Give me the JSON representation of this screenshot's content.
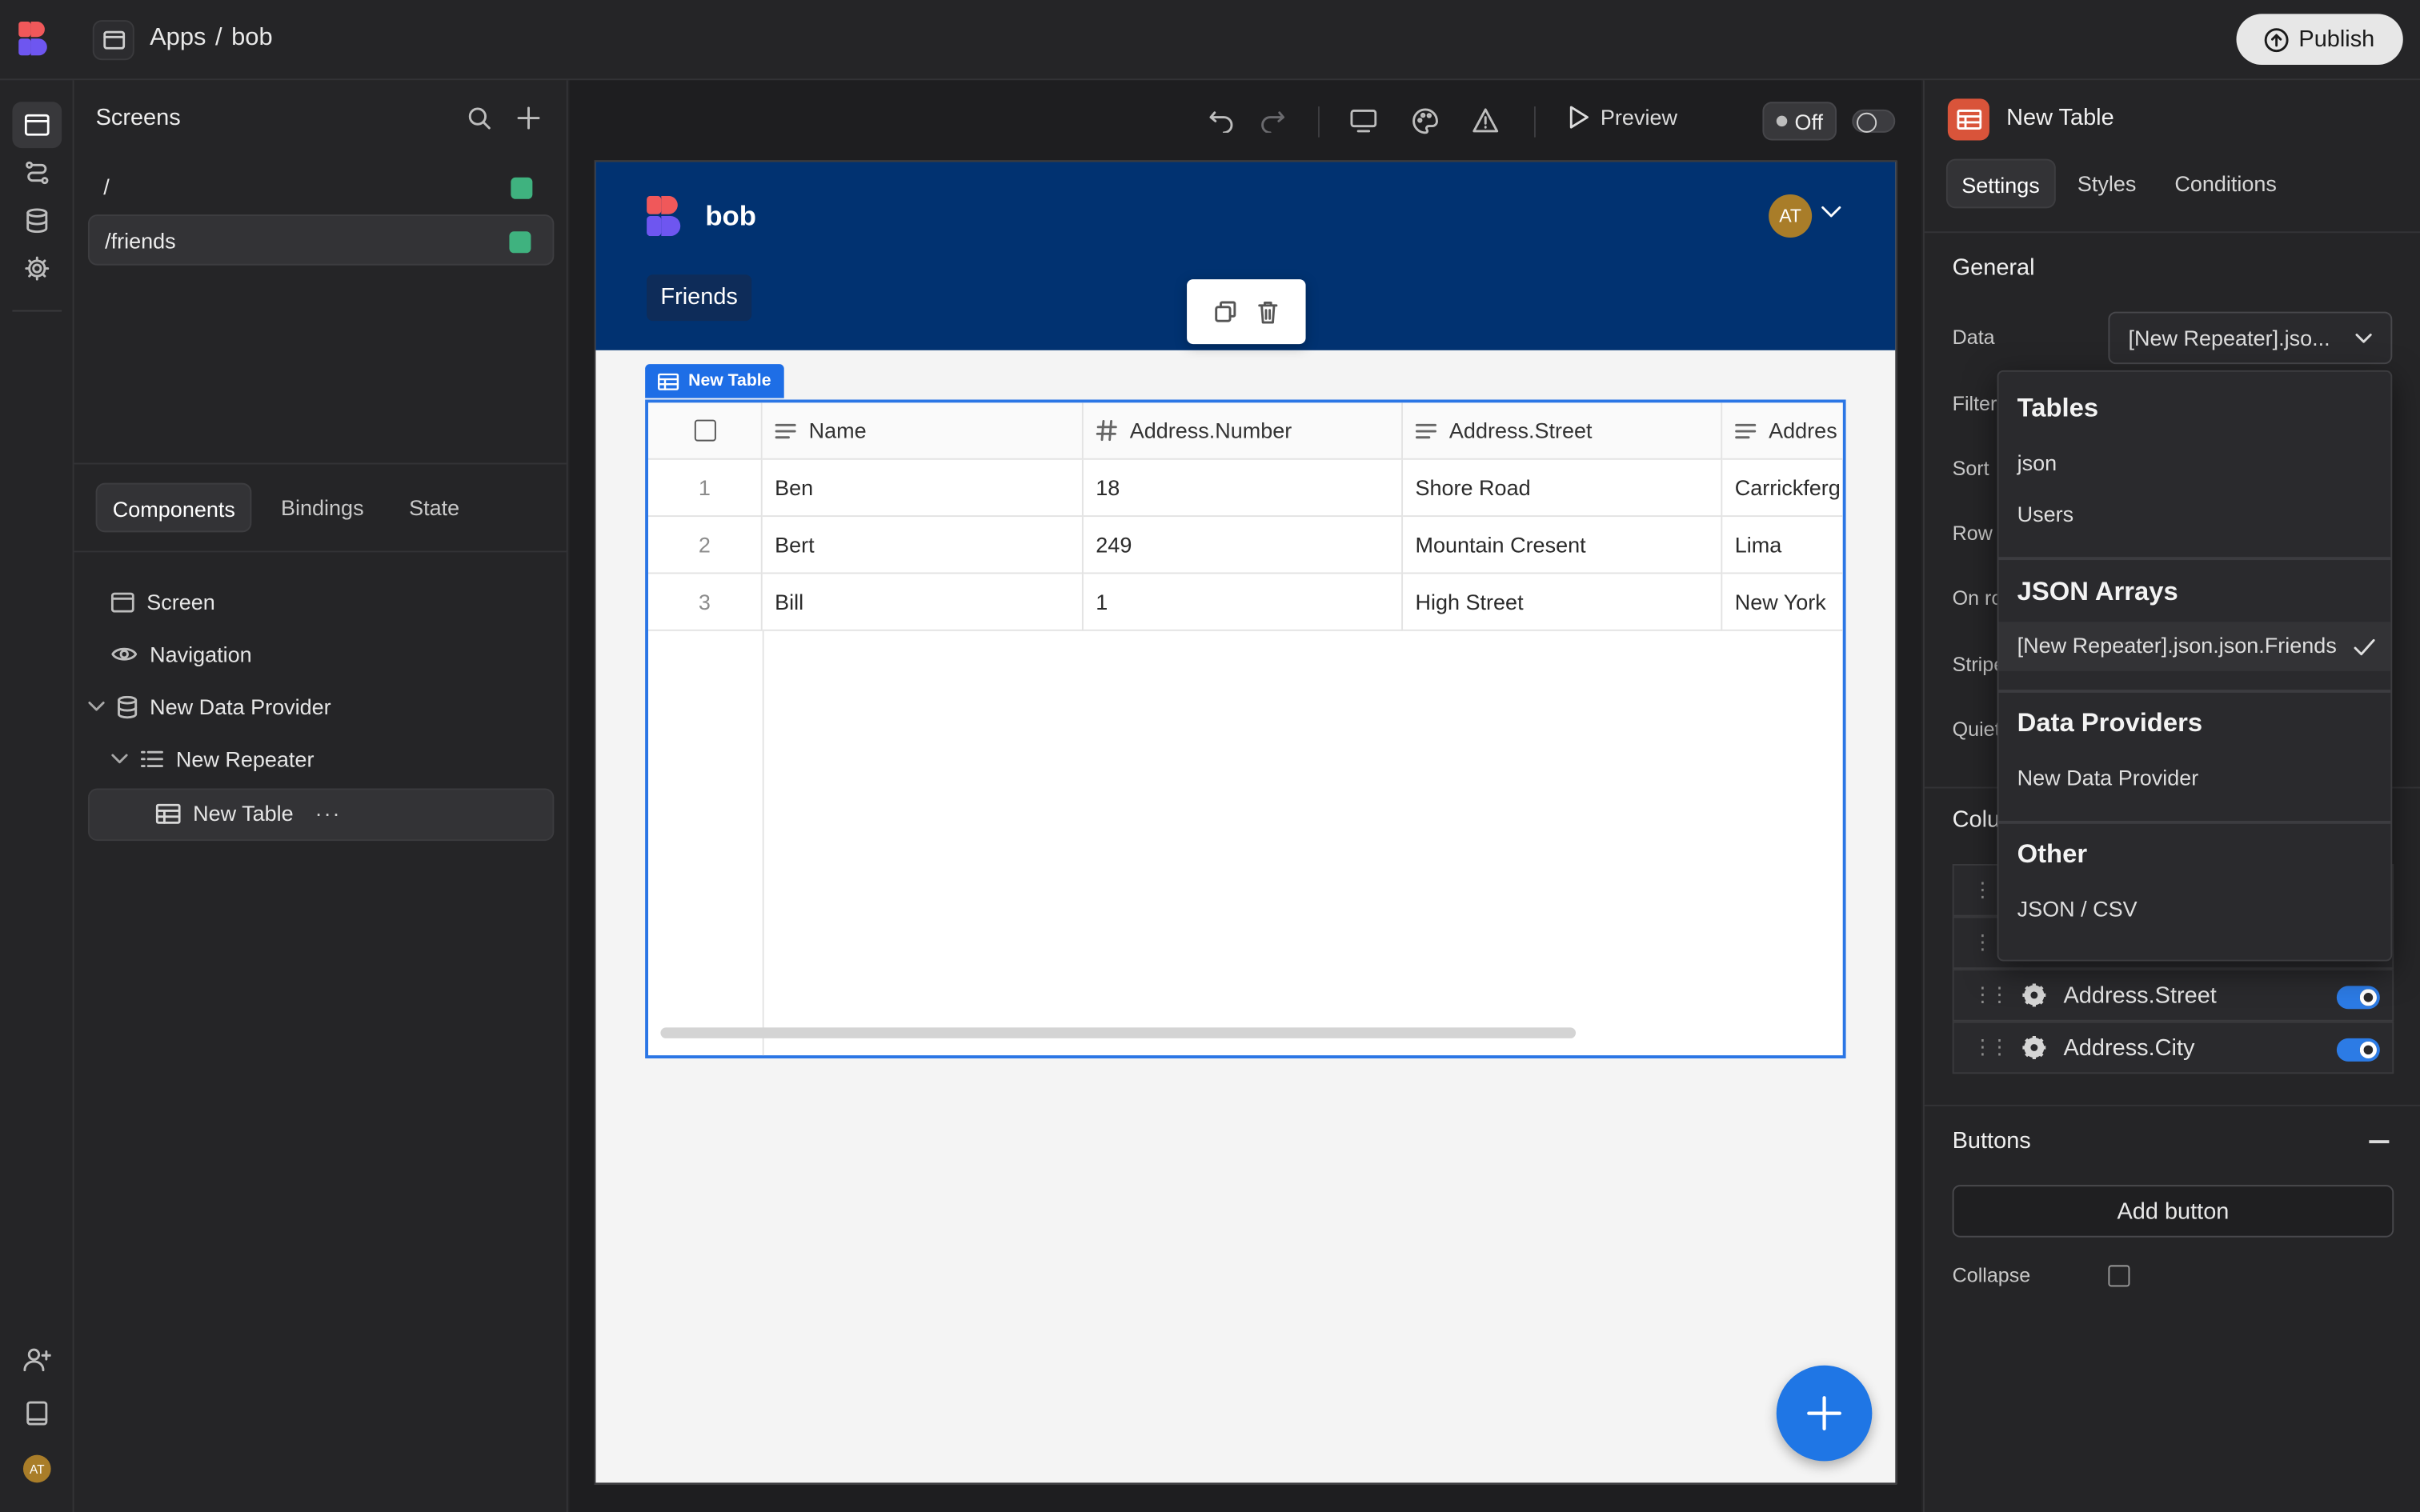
{
  "topbar": {
    "breadcrumb": [
      "Apps",
      "/",
      "bob"
    ],
    "publish_label": "Publish"
  },
  "screens_panel": {
    "title": "Screens",
    "routes": [
      {
        "path": "/",
        "active": false
      },
      {
        "path": "/friends",
        "active": true
      }
    ]
  },
  "left_tabs": [
    "Components",
    "Bindings",
    "State"
  ],
  "component_tree": [
    {
      "label": "Screen",
      "icon": "screen-icon"
    },
    {
      "label": "Navigation",
      "icon": "eye-icon"
    },
    {
      "label": "New Data Provider",
      "icon": "database-icon"
    },
    {
      "label": "New Repeater",
      "icon": "list-icon"
    },
    {
      "label": "New Table",
      "icon": "table-icon"
    }
  ],
  "canvas_toolbar": {
    "preview_label": "Preview",
    "off_label": "Off"
  },
  "app_preview": {
    "app_name": "bob",
    "avatar_initials": "AT",
    "nav_item": "Friends",
    "table_tag": "New Table",
    "table": {
      "headers": [
        "Name",
        "Address.Number",
        "Address.Street",
        "Addres"
      ],
      "header_icons": [
        "text-icon",
        "hash-icon",
        "text-icon",
        "text-icon"
      ],
      "rows": [
        {
          "n": "1",
          "cells": [
            "Ben",
            "18",
            "Shore Road",
            "Carrickferg"
          ]
        },
        {
          "n": "2",
          "cells": [
            "Bert",
            "249",
            "Mountain Cresent",
            "Lima"
          ]
        },
        {
          "n": "3",
          "cells": [
            "Bill",
            "1",
            "High Street",
            "New York"
          ]
        }
      ]
    }
  },
  "right_panel": {
    "title": "New Table",
    "tabs": [
      "Settings",
      "Styles",
      "Conditions"
    ],
    "general_title": "General",
    "labels": [
      "Data",
      "Filter",
      "Sort",
      "Row",
      "On ro",
      "Stripe",
      "Quiet"
    ],
    "data_value": "[New Repeater].jso...",
    "columns_title": "Colu",
    "columns": [
      "Address.Street",
      "Address.City"
    ],
    "buttons_title": "Buttons",
    "add_button_label": "Add button",
    "collapse_label": "Collapse"
  },
  "dropdown": {
    "sections": [
      {
        "title": "Tables",
        "items": [
          "json",
          "Users"
        ]
      },
      {
        "title": "JSON Arrays",
        "items": [
          "[New Repeater].json.json.Friends"
        ]
      },
      {
        "title": "Data Providers",
        "items": [
          "New Data Provider"
        ]
      },
      {
        "title": "Other",
        "items": [
          "JSON / CSV"
        ]
      }
    ]
  },
  "user_initials": "AT",
  "colors": {
    "accent": "#2b76e5",
    "app_header": "#013271",
    "route_status": "#3fb27f",
    "avatar": "#a97d29"
  }
}
